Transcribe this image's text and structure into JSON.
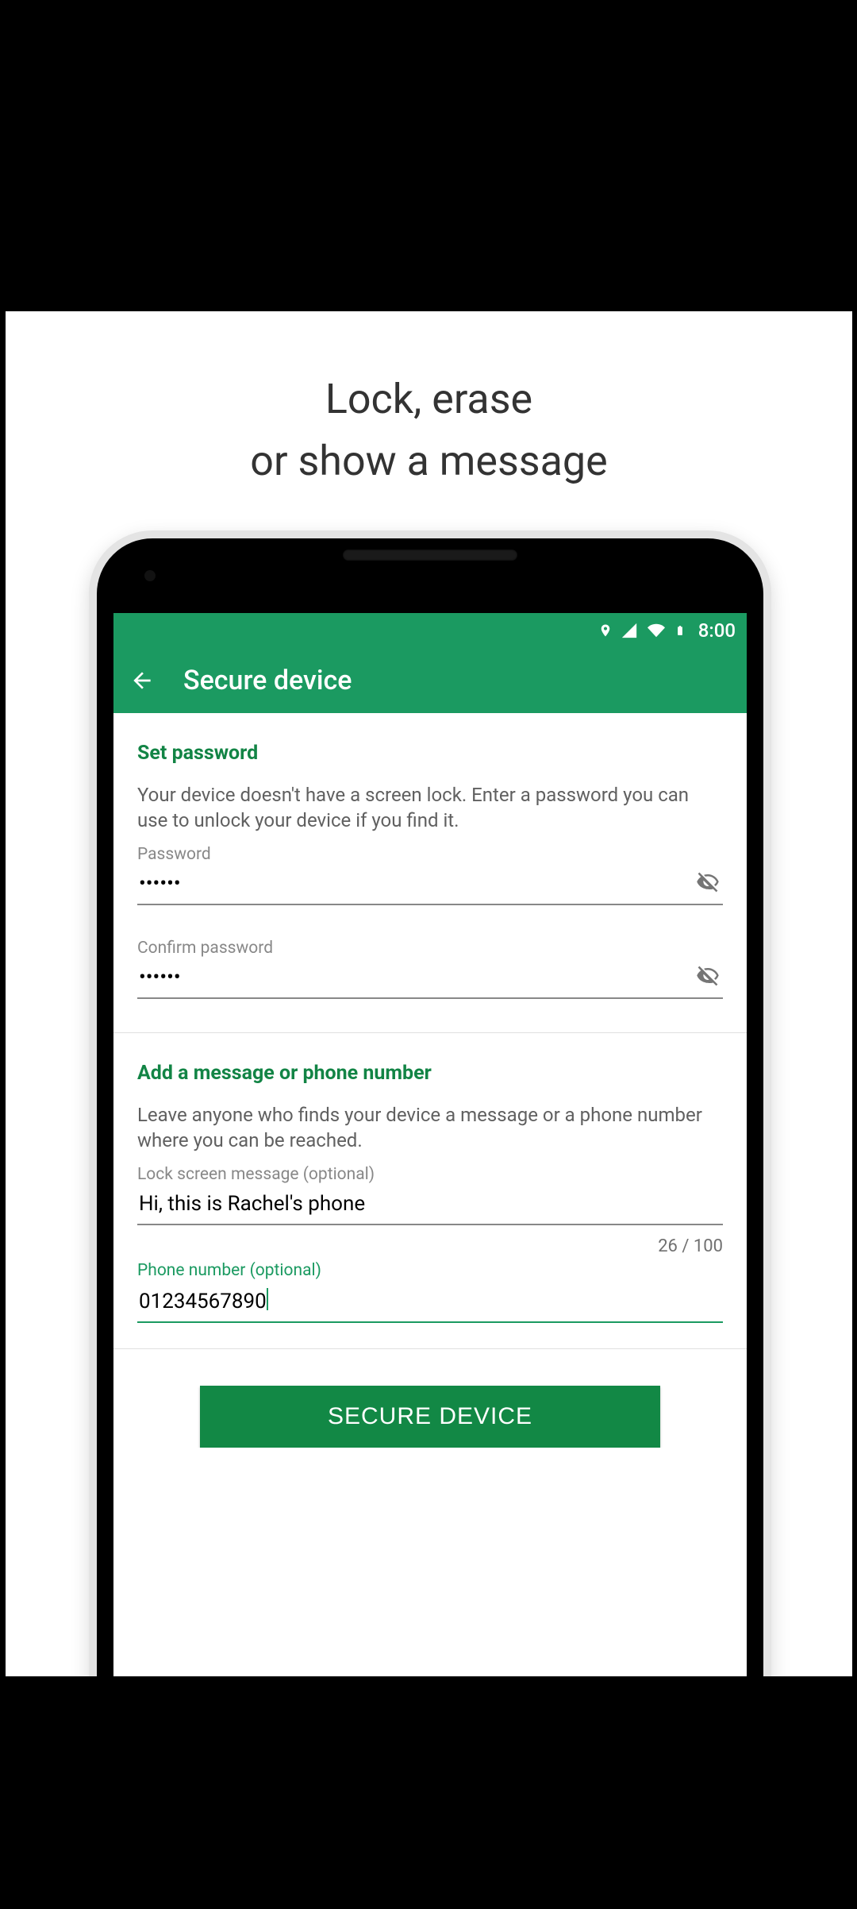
{
  "promo": {
    "line1": "Lock, erase",
    "line2": "or show a message"
  },
  "status_bar": {
    "time": "8:00"
  },
  "app_bar": {
    "title": "Secure device"
  },
  "password_section": {
    "title": "Set password",
    "description": "Your device doesn't have a screen lock. Enter a password you can use to unlock your device if you find it.",
    "password_label": "Password",
    "password_masked": "••••••",
    "confirm_label": "Confirm password",
    "confirm_masked": "••••••"
  },
  "message_section": {
    "title": "Add a message or phone number",
    "description": "Leave anyone who finds your device a message or a phone number where you can be reached.",
    "lock_message_label": "Lock screen message (optional)",
    "lock_message_value": "Hi, this is Rachel's phone",
    "lock_message_counter": "26 / 100",
    "phone_label": "Phone number (optional)",
    "phone_value": "01234567890"
  },
  "cta": {
    "label": "SECURE DEVICE"
  }
}
